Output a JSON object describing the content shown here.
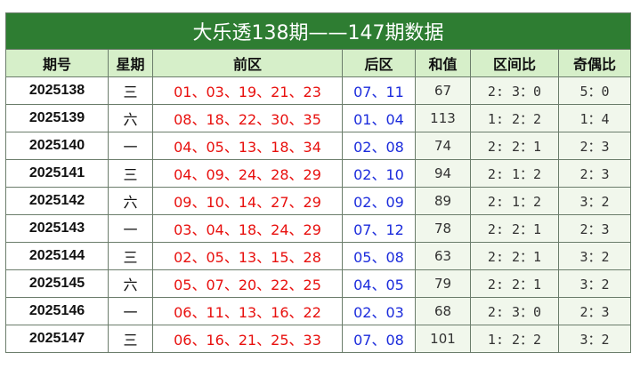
{
  "title": "大乐透138期——147期数据",
  "headers": [
    "期号",
    "星期",
    "前区",
    "后区",
    "和值",
    "区间比",
    "奇偶比"
  ],
  "rows": [
    {
      "issue": "2025138",
      "weekday": "三",
      "front": "01、03、19、21、23",
      "back": "07、11",
      "sum": "67",
      "zone": "2: 3：0",
      "odd_even": "5：0"
    },
    {
      "issue": "2025139",
      "weekday": "六",
      "front": "08、18、22、30、35",
      "back": "01、04",
      "sum": "113",
      "zone": "1: 2：2",
      "odd_even": "1：4"
    },
    {
      "issue": "2025140",
      "weekday": "一",
      "front": "04、05、13、18、34",
      "back": "02、08",
      "sum": "74",
      "zone": "2: 2：1",
      "odd_even": "2：3"
    },
    {
      "issue": "2025141",
      "weekday": "三",
      "front": "04、09、24、28、29",
      "back": "02、10",
      "sum": "94",
      "zone": "2: 1：2",
      "odd_even": "2：3"
    },
    {
      "issue": "2025142",
      "weekday": "六",
      "front": "09、10、14、27、29",
      "back": "02、09",
      "sum": "89",
      "zone": "2: 1：2",
      "odd_even": "3：2"
    },
    {
      "issue": "2025143",
      "weekday": "一",
      "front": "03、04、18、24、29",
      "back": "07、12",
      "sum": "78",
      "zone": "2: 2：1",
      "odd_even": "2：3"
    },
    {
      "issue": "2025144",
      "weekday": "三",
      "front": "02、05、13、15、28",
      "back": "05、08",
      "sum": "63",
      "zone": "2: 2：1",
      "odd_even": "3：2"
    },
    {
      "issue": "2025145",
      "weekday": "六",
      "front": "05、07、20、22、25",
      "back": "04、05",
      "sum": "79",
      "zone": "2: 2：1",
      "odd_even": "3：2"
    },
    {
      "issue": "2025146",
      "weekday": "一",
      "front": "06、11、13、16、22",
      "back": "02、03",
      "sum": "68",
      "zone": "2: 3：0",
      "odd_even": "2：3"
    },
    {
      "issue": "2025147",
      "weekday": "三",
      "front": "06、16、21、25、33",
      "back": "07、08",
      "sum": "101",
      "zone": "1: 2：2",
      "odd_even": "3：2"
    }
  ],
  "colors": {
    "title_bg": "#2e7d32",
    "header_bg": "#d6efc9",
    "front_red": "#e8100e",
    "back_blue": "#1b2bdc"
  }
}
